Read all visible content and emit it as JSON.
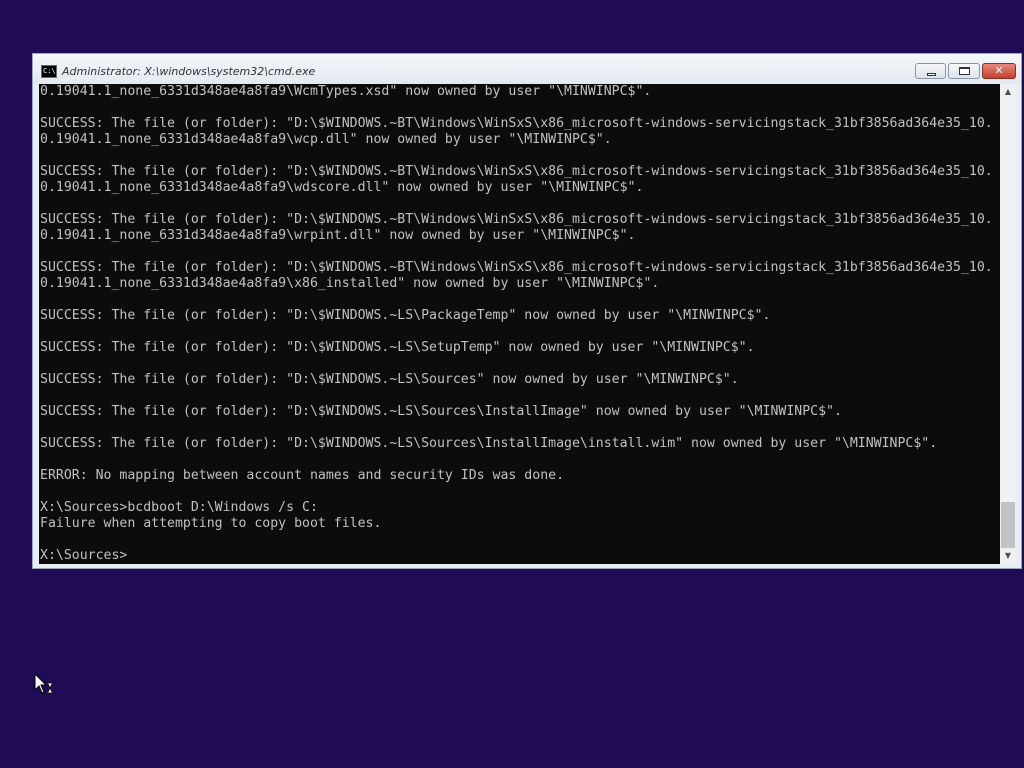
{
  "window": {
    "title": "Administrator: X:\\windows\\system32\\cmd.exe",
    "icon_label": "C:\\",
    "buttons": {
      "minimize": "minimize-icon",
      "maximize": "maximize-icon",
      "close": "close-icon",
      "close_glyph": "✕"
    }
  },
  "console": {
    "lines": [
      "0.19041.1_none_6331d348ae4a8fa9\\WcmTypes.xsd\" now owned by user \"\\MINWINPC$\".",
      "",
      "SUCCESS: The file (or folder): \"D:\\$WINDOWS.~BT\\Windows\\WinSxS\\x86_microsoft-windows-servicingstack_31bf3856ad364e35_10.",
      "0.19041.1_none_6331d348ae4a8fa9\\wcp.dll\" now owned by user \"\\MINWINPC$\".",
      "",
      "SUCCESS: The file (or folder): \"D:\\$WINDOWS.~BT\\Windows\\WinSxS\\x86_microsoft-windows-servicingstack_31bf3856ad364e35_10.",
      "0.19041.1_none_6331d348ae4a8fa9\\wdscore.dll\" now owned by user \"\\MINWINPC$\".",
      "",
      "SUCCESS: The file (or folder): \"D:\\$WINDOWS.~BT\\Windows\\WinSxS\\x86_microsoft-windows-servicingstack_31bf3856ad364e35_10.",
      "0.19041.1_none_6331d348ae4a8fa9\\wrpint.dll\" now owned by user \"\\MINWINPC$\".",
      "",
      "SUCCESS: The file (or folder): \"D:\\$WINDOWS.~BT\\Windows\\WinSxS\\x86_microsoft-windows-servicingstack_31bf3856ad364e35_10.",
      "0.19041.1_none_6331d348ae4a8fa9\\x86_installed\" now owned by user \"\\MINWINPC$\".",
      "",
      "SUCCESS: The file (or folder): \"D:\\$WINDOWS.~LS\\PackageTemp\" now owned by user \"\\MINWINPC$\".",
      "",
      "SUCCESS: The file (or folder): \"D:\\$WINDOWS.~LS\\SetupTemp\" now owned by user \"\\MINWINPC$\".",
      "",
      "SUCCESS: The file (or folder): \"D:\\$WINDOWS.~LS\\Sources\" now owned by user \"\\MINWINPC$\".",
      "",
      "SUCCESS: The file (or folder): \"D:\\$WINDOWS.~LS\\Sources\\InstallImage\" now owned by user \"\\MINWINPC$\".",
      "",
      "SUCCESS: The file (or folder): \"D:\\$WINDOWS.~LS\\Sources\\InstallImage\\install.wim\" now owned by user \"\\MINWINPC$\".",
      "",
      "ERROR: No mapping between account names and security IDs was done.",
      "",
      "X:\\Sources>bcdboot D:\\Windows /s C:",
      "Failure when attempting to copy boot files.",
      "",
      "X:\\Sources>"
    ]
  },
  "scrollbar": {
    "up_arrow": "▲",
    "down_arrow": "▼"
  },
  "cursor": {
    "icon": "busy-pointer-icon"
  },
  "colors": {
    "desktop": "#200b57",
    "console_bg": "#0c0c0c",
    "console_text": "#c0c0c0"
  }
}
